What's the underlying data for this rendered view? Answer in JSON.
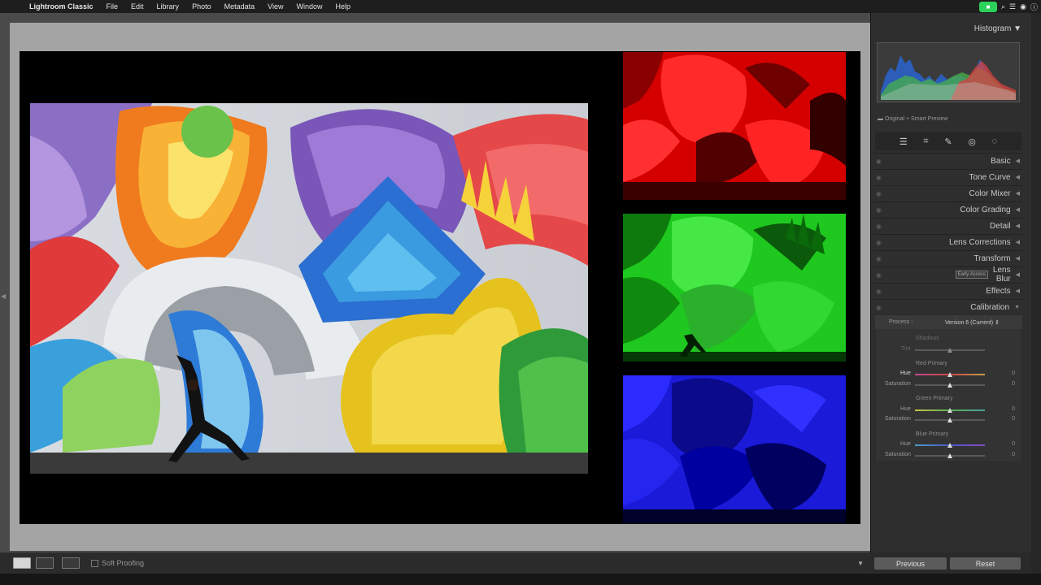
{
  "menubar": {
    "apple_icon": "apple-icon",
    "app_name": "Lightroom Classic",
    "menus": [
      "File",
      "Edit",
      "Library",
      "Photo",
      "Metadata",
      "View",
      "Window",
      "Help"
    ]
  },
  "toolbar": {
    "soft_proofing_label": "Soft Proofing"
  },
  "panel": {
    "histogram_title": "Histogram",
    "histogram_subtitle": "Original + Smart Preview",
    "sections": [
      "Basic",
      "Tone Curve",
      "Color Mixer",
      "Color Grading",
      "Detail",
      "Lens Corrections",
      "Transform",
      "Lens Blur",
      "Effects",
      "Calibration"
    ],
    "early_access_badge": "Early Access",
    "calibration": {
      "process_label": "Process :",
      "process_value": "Version 6 (Current)",
      "shadows_title": "Shadows",
      "tint_label": "Tint",
      "red_primary_title": "Red Primary",
      "green_primary_title": "Green Primary",
      "blue_primary_title": "Blue Primary",
      "hue_label": "Hue",
      "saturation_label": "Saturation",
      "values": {
        "red_hue": "0",
        "red_sat": "0",
        "green_hue": "0",
        "green_sat": "0",
        "blue_hue": "0",
        "blue_sat": "0"
      }
    },
    "previous_label": "Previous",
    "reset_label": "Reset"
  }
}
